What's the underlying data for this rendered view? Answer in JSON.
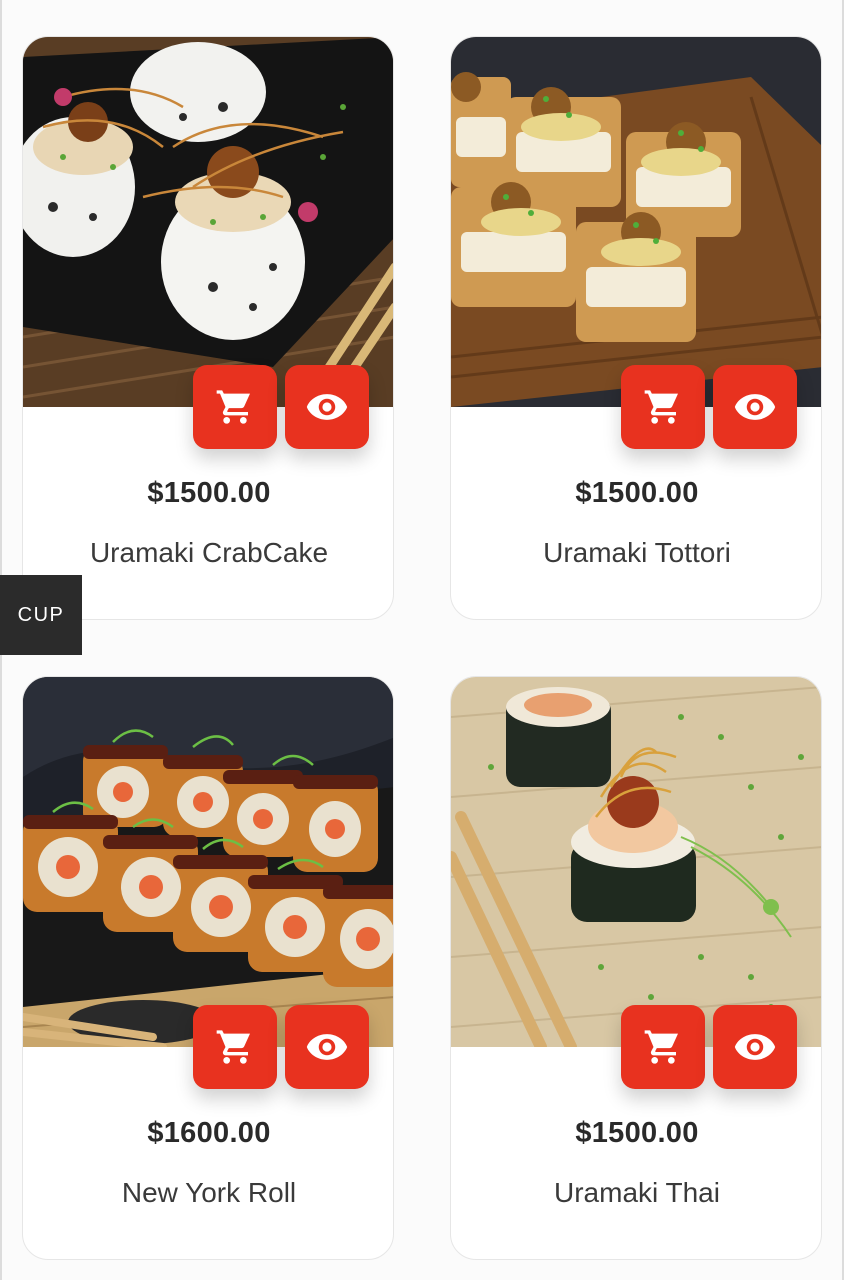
{
  "colors": {
    "accent": "#e8321f",
    "side_tab_bg": "#2b2b2b",
    "text": "#2a2a2a"
  },
  "products": [
    {
      "name": "Uramaki CrabCake",
      "price": "$1500.00",
      "cart_icon": "cart-icon",
      "view_icon": "eye-icon"
    },
    {
      "name": "Uramaki Tottori",
      "price": "$1500.00",
      "cart_icon": "cart-icon",
      "view_icon": "eye-icon"
    },
    {
      "name": "New York Roll",
      "price": "$1600.00",
      "cart_icon": "cart-icon",
      "view_icon": "eye-icon"
    },
    {
      "name": "Uramaki Thai",
      "price": "$1500.00",
      "cart_icon": "cart-icon",
      "view_icon": "eye-icon"
    }
  ],
  "side_tab": {
    "label": "CUP"
  }
}
